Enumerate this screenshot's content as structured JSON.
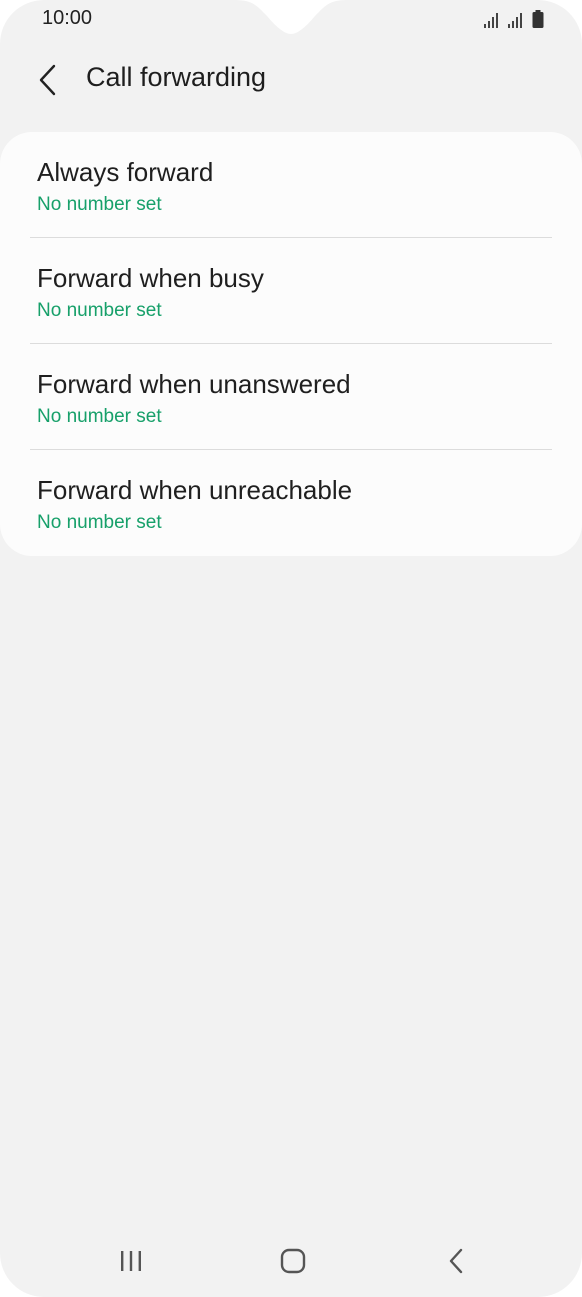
{
  "status_bar": {
    "time": "10:00",
    "icons": [
      "signal-icon",
      "signal-icon",
      "battery-icon"
    ]
  },
  "header": {
    "title": "Call forwarding",
    "back_icon": "chevron-left-icon"
  },
  "options": [
    {
      "title": "Always forward",
      "subtitle": "No number set"
    },
    {
      "title": "Forward when busy",
      "subtitle": "No number set"
    },
    {
      "title": "Forward when unanswered",
      "subtitle": "No number set"
    },
    {
      "title": "Forward when unreachable",
      "subtitle": "No number set"
    }
  ],
  "navigation": {
    "recents_icon": "recents-icon",
    "home_icon": "home-icon",
    "back_icon": "back-icon"
  },
  "colors": {
    "background": "#f2f2f2",
    "card": "#fcfcfc",
    "accent": "#17a06a",
    "text": "#1f1f1f"
  }
}
